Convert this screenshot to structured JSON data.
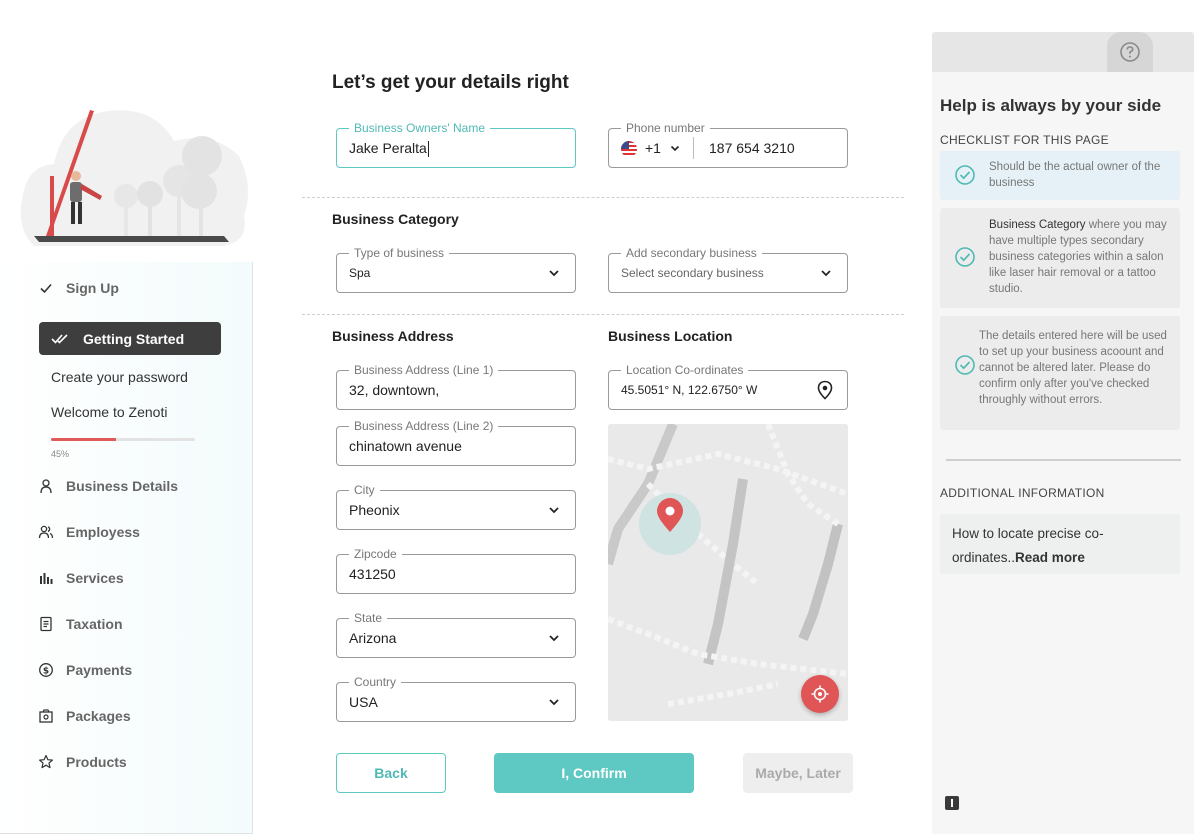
{
  "sidebar": {
    "steps": [
      {
        "label": "Sign Up",
        "icon": "check-icon",
        "done": true
      },
      {
        "label": "Getting Started",
        "icon": "double-check-icon",
        "active": true
      },
      {
        "label": "Business Details",
        "icon": "person-icon"
      },
      {
        "label": "Employess",
        "icon": "people-icon"
      },
      {
        "label": "Services",
        "icon": "bar-chart-icon"
      },
      {
        "label": "Taxation",
        "icon": "document-icon"
      },
      {
        "label": "Payments",
        "icon": "dollar-coin-icon"
      },
      {
        "label": "Packages",
        "icon": "package-icon"
      },
      {
        "label": "Products",
        "icon": "star-icon"
      }
    ],
    "substeps": [
      "Create your password",
      "Welcome to Zenoti"
    ],
    "progress": {
      "percent": 45,
      "label": "45%"
    }
  },
  "main": {
    "title": "Let’s get your details right",
    "owner_name": {
      "label": "Business Owners' Name",
      "value": "Jake Peralta"
    },
    "phone": {
      "label": "Phone number",
      "country_code": "+1",
      "number": "187 654 3210",
      "flag": "us-flag-icon"
    },
    "category_section": "Business Category",
    "type_of_business": {
      "label": "Type of  business",
      "value": "Spa"
    },
    "secondary_business": {
      "label": "Add secondary business",
      "placeholder": "Select secondary business"
    },
    "address_section": "Business Address",
    "location_section": "Business Location",
    "address_line1": {
      "label": "Business Address (Line 1)",
      "value": "32, downtown,"
    },
    "address_line2": {
      "label": "Business Address (Line 2)",
      "value": "chinatown avenue"
    },
    "city": {
      "label": "City",
      "value": "Pheonix"
    },
    "zipcode": {
      "label": "Zipcode",
      "value": "431250"
    },
    "state": {
      "label": "State",
      "value": "Arizona"
    },
    "country": {
      "label": "Country",
      "value": "USA"
    },
    "coordinates": {
      "label": "Location Co-ordinates",
      "value": "45.5051° N, 122.6750° W"
    }
  },
  "buttons": {
    "back": "Back",
    "confirm": "I, Confirm",
    "later": "Maybe, Later"
  },
  "help": {
    "title": "Help is always by your side",
    "checklist_title": "CHECKLIST FOR THIS PAGE",
    "checklist": [
      {
        "text": "Should be the actual owner of the business"
      },
      {
        "bold": "Business Category",
        "text": " where you may have multiple types secondary business categories within a salon like laser hair removal or a tattoo studio."
      },
      {
        "text": "The details entered here will be used to set up your business acoount and cannot be altered later. Please do confirm only after you've checked throughly without errors."
      }
    ],
    "info_title": "ADDITIONAL INFORMATION",
    "info_text": "How to locate precise co-ordinates..",
    "info_link": "Read more"
  },
  "colors": {
    "accent": "#5ec8c3",
    "active_step": "#3e3e3e",
    "progress": "#e05a5a",
    "map_pin": "#e05555"
  }
}
